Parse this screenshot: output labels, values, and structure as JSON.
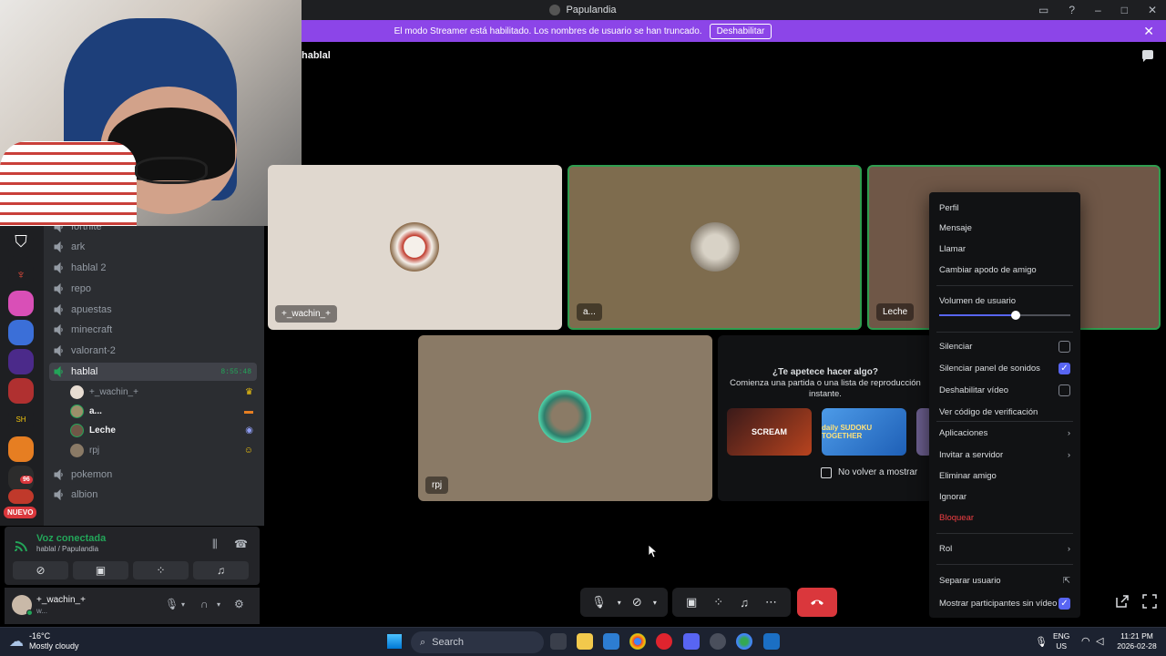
{
  "window": {
    "title": "Papulandia"
  },
  "banner": {
    "text": "El modo Streamer está habilitado. Los nombres de usuario se han truncado.",
    "button": "Deshabilitar",
    "color": "#8c45e8"
  },
  "channel_header": "hablal",
  "channels": {
    "partial_top": "fortnite",
    "items": [
      "ark",
      "hablal 2",
      "repo",
      "apuestas",
      "minecraft",
      "valorant-2"
    ],
    "active": {
      "name": "hablal",
      "timer": "8:55:48"
    },
    "voice_users": [
      {
        "name": "+_wachin_+",
        "status_icon": "crown-icon"
      },
      {
        "name": "a...",
        "status_icon": "flag-icon"
      },
      {
        "name": "Leche",
        "status_icon": "gamepad-icon"
      },
      {
        "name": "rpj",
        "status_icon": "headphones-icon"
      }
    ],
    "after": [
      "pokemon",
      "albion"
    ]
  },
  "rail": {
    "new_label": "NUEVO",
    "badge": "96"
  },
  "voice_panel": {
    "title": "Voz conectada",
    "subtitle": "hablal / Papulandia",
    "accent": "#23a559"
  },
  "user_panel": {
    "name": "+_wachin_+",
    "status": "w..."
  },
  "tiles": [
    {
      "name": "+_wachin_+",
      "bg": "#e0d8cf"
    },
    {
      "name": "a...",
      "bg": "#7e6c4e"
    },
    {
      "name": "Leche",
      "bg": "#6f5747"
    },
    {
      "name": "rpj",
      "bg": "#8a7a66"
    }
  ],
  "activity": {
    "line1": "¿Te apetece hacer algo?",
    "line2": "Comienza una partida o una lista de reproducción",
    "line3": "instante.",
    "cards": [
      "SCREAM",
      "daily SUDOKU TOGETHER"
    ],
    "checkbox_label": "No volver a mostrar"
  },
  "context_menu": {
    "items_top": [
      "Perfil",
      "Mensaje",
      "Llamar",
      "Cambiar apodo de amigo"
    ],
    "volume_label": "Volumen de usuario",
    "volume_level": 0.58,
    "checkboxes": [
      {
        "label": "Silenciar",
        "checked": false
      },
      {
        "label": "Silenciar panel de sonidos",
        "checked": true
      },
      {
        "label": "Deshabilitar vídeo",
        "checked": false
      }
    ],
    "verify": "Ver código de verificación",
    "apps": "Aplicaciones",
    "invite": "Invitar a servidor",
    "remove": "Eliminar amigo",
    "ignore": "Ignorar",
    "block": "Bloquear",
    "role": "Rol",
    "separate": "Separar usuario",
    "show_no_video": "Mostrar participantes sin vídeo"
  },
  "taskbar": {
    "weather_temp": "-16°C",
    "weather_desc": "Mostly cloudy",
    "search": "Search",
    "lang1": "ENG",
    "lang2": "US",
    "time": "11:21 PM",
    "date": "2026-02-28"
  }
}
